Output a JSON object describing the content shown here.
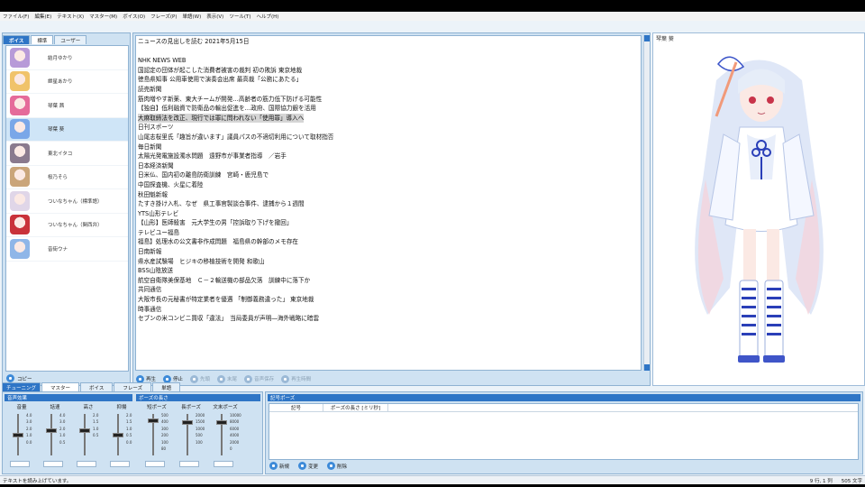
{
  "menu": [
    "ファイル(F)",
    "編集(E)",
    "テキスト(X)",
    "マスター(M)",
    "ボイス(O)",
    "フレーズ(P)",
    "単語(W)",
    "表示(V)",
    "ツール(T)",
    "ヘルプ(H)"
  ],
  "left_panel": {
    "title_tab": "ボイス",
    "tabs": [
      "標準",
      "ユーザー"
    ],
    "voices": [
      {
        "name": "結月ゆかり",
        "color": "#b79ad8"
      },
      {
        "name": "紲星あかり",
        "color": "#f0c36b"
      },
      {
        "name": "琴葉 茜",
        "color": "#e56b9a"
      },
      {
        "name": "琴葉 葵",
        "color": "#7aa7e8",
        "selected": true
      },
      {
        "name": "東北イタコ",
        "color": "#8a7a8e"
      },
      {
        "name": "桜乃そら",
        "color": "#caa57a"
      },
      {
        "name": "ついなちゃん（標準語）",
        "color": "#e0d6e8"
      },
      {
        "name": "ついなちゃん（関西弁）",
        "color": "#c9323a"
      },
      {
        "name": "音街ウナ",
        "color": "#8fb6e8"
      }
    ],
    "copy_label": "コピー"
  },
  "editor": {
    "lines": [
      "ニュースの見出しを読む 2021年5月15日",
      "",
      "NHK NEWS WEB",
      "国認定の団体が起こした消費者被害の裁判 初の敗訴 東京地裁",
      "徳島県知事 公用車使用で演奏会出席 最高裁「公務にあたる」",
      "読売新聞",
      "筋肉増やす新薬、東大チームが開発…高齢者の筋力低下防げる可能性",
      "【独自】低利融資で防衛品の輸出促進を…政府、国際協力銀を活用",
      "大麻取締法を改正、現行では罪に問われない「使用罪」導入へ",
      "日刊スポーツ",
      "山尾志桜里氏「趣旨が違います」議員パスの不適切利用について取材指否",
      "毎日新聞",
      "太陽光発電施設濁水問題　遠野市が事業者指導　／岩手",
      "日本経済新聞",
      "日米仏、国内初の離島防衛訓練　宮崎・鹿児島で",
      "中国探査機、火星に着陸",
      "秋田魁新報",
      "たすき掛け入札、なぜ　県工事官製談合事件、逮捕から１週間",
      "YTS山形テレビ",
      "【山形】医師殺害　元大学生の男「控訴取り下げを撤回」",
      "テレビユー福島",
      "福島】処理水の公文書非作成問題　福島県の幹部のメモ存在",
      "日南新報",
      "県水産試験場　ヒジキの移植技術を開発 和歌山",
      "BSS山陰放送",
      "航空自衛隊美保基地　Ｃ－２輸送機の部品欠落　訓練中に落下か",
      "共同通信",
      "大阪市長の元秘書が特定業者を優遇 「制御義務違った」 東京地裁",
      "時事通信",
      "セブンの米コンビニ買収「違法」　当局委員が声明―海外戦略に暗雲"
    ],
    "highlight_index": 8,
    "buttons": [
      {
        "label": "再生",
        "enabled": true
      },
      {
        "label": "停止",
        "enabled": true
      },
      {
        "label": "先頭",
        "enabled": false
      },
      {
        "label": "末尾",
        "enabled": false
      },
      {
        "label": "音声保存",
        "enabled": false
      },
      {
        "label": "再生時間",
        "enabled": false
      }
    ]
  },
  "character": {
    "title": "琴葉 葵"
  },
  "tuning": {
    "title_tab": "チューニング",
    "tabs": [
      "マスター",
      "ボイス",
      "フレーズ",
      "単語"
    ],
    "voice_effect_label": "音声効果",
    "pause_length_label": "ポーズの長さ",
    "sliders": [
      {
        "label": "音量",
        "ticks": [
          "4.0",
          "3.0",
          "2.0",
          "1.0",
          "0.0"
        ],
        "level": 0.5
      },
      {
        "label": "話速",
        "ticks": [
          "4.0",
          "3.0",
          "2.0",
          "1.0",
          "0.5"
        ],
        "level": 0.6
      },
      {
        "label": "高さ",
        "ticks": [
          "2.0",
          "1.5",
          "1.0",
          "0.5"
        ],
        "level": 0.6
      },
      {
        "label": "抑揚",
        "ticks": [
          "2.0",
          "1.5",
          "1.0",
          "0.5",
          "0.0"
        ],
        "level": 0.5
      },
      {
        "label": "短ポーズ",
        "ticks": [
          "500",
          "400",
          "300",
          "200",
          "100",
          "80"
        ],
        "level": 0.85
      },
      {
        "label": "長ポーズ",
        "ticks": [
          "2000",
          "1500",
          "1000",
          "500",
          "100"
        ],
        "level": 0.8
      },
      {
        "label": "文末ポーズ",
        "ticks": [
          "10000",
          "8000",
          "6000",
          "4000",
          "2000",
          "0"
        ],
        "level": 0.8
      }
    ]
  },
  "pause_panel": {
    "title": "記号ポーズ",
    "columns": [
      "記号",
      "ポーズの長さ [ミリ秒]"
    ],
    "actions": [
      "新規",
      "変更",
      "削除"
    ]
  },
  "status": {
    "message": "テキストを読み上げています。",
    "position": "9 行, 1 列",
    "chars": "505 文字"
  },
  "colors": {
    "accent": "#2e75c6",
    "panel": "#cfe2f2"
  }
}
